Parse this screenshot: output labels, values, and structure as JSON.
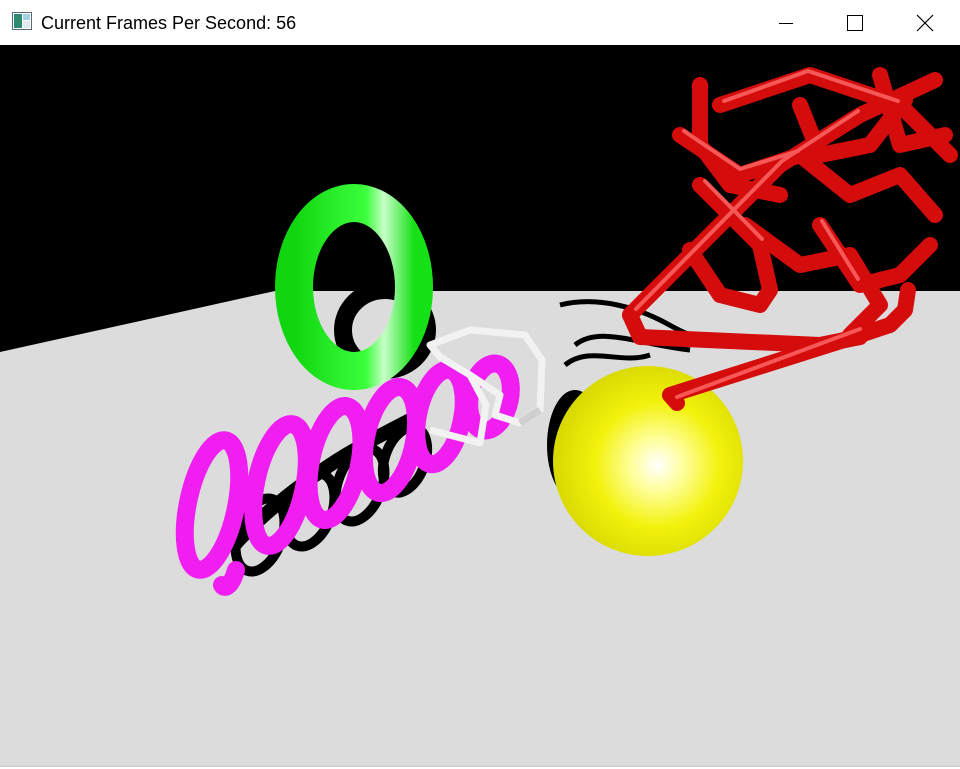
{
  "window": {
    "title": "Current Frames Per Second: 56",
    "icon": "app-window-icon"
  },
  "caption_buttons": {
    "minimize": "minimize-icon",
    "maximize": "maximize-icon",
    "close": "close-icon"
  },
  "scene": {
    "background_color": "#000000",
    "floor_color": "#dcdcdc",
    "objects": [
      {
        "name": "green-torus",
        "color": "#19f019"
      },
      {
        "name": "magenta-coil",
        "color": "#f01ef0"
      },
      {
        "name": "white-wire-knot",
        "color": "#f2f2f2"
      },
      {
        "name": "yellow-sphere",
        "color": "#f0f00a"
      },
      {
        "name": "red-tube-knot",
        "color": "#e61010"
      }
    ]
  }
}
